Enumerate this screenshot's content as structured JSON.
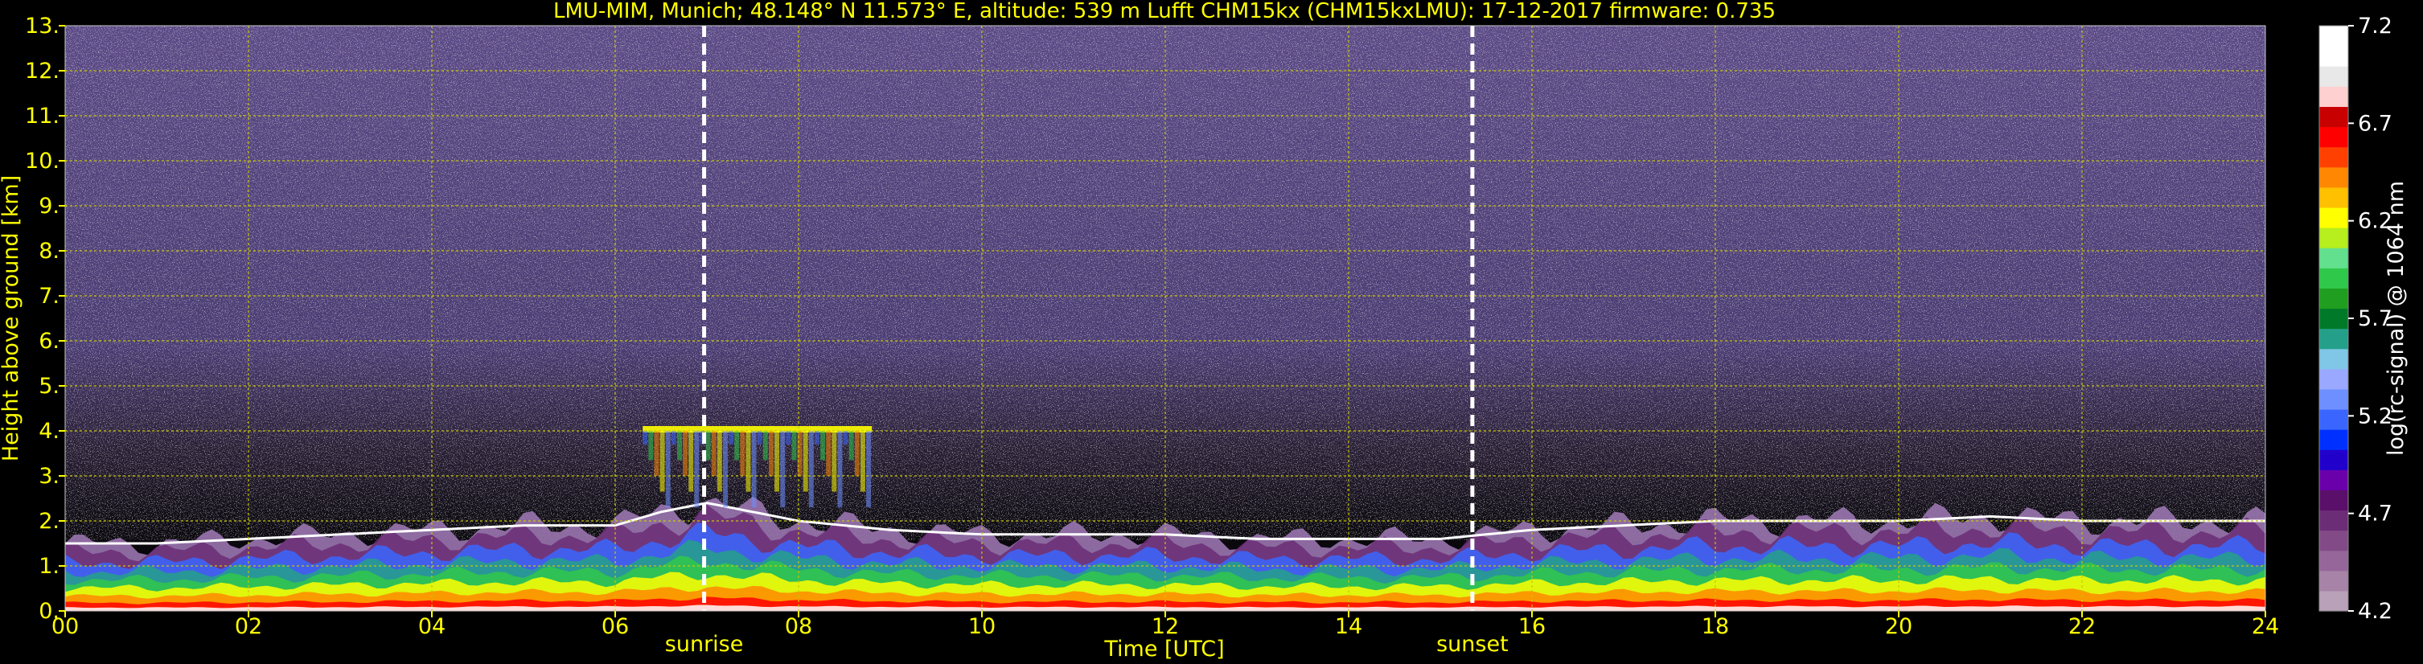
{
  "chart_data": {
    "type": "heatmap",
    "title": "LMU-MIM, Munich; 48.148° N 11.573° E, altitude: 539 m    Lufft CHM15kx (CHM15kxLMU): 17-12-2017    firmware: 0.735",
    "xlabel": "Time [UTC]",
    "ylabel": "Height above ground [km]",
    "xlim": [
      0,
      24
    ],
    "ylim": [
      0,
      13
    ],
    "x_ticks": [
      "00",
      "02",
      "04",
      "06",
      "08",
      "10",
      "12",
      "14",
      "16",
      "18",
      "20",
      "22",
      "24"
    ],
    "y_ticks": [
      "0.",
      "1.",
      "2.",
      "3.",
      "4.",
      "5.",
      "6.",
      "7.",
      "8.",
      "9.",
      "10.",
      "11.",
      "12.",
      "13."
    ],
    "grid": true,
    "markers": [
      {
        "label": "sunrise",
        "x": 6.97
      },
      {
        "label": "sunset",
        "x": 15.35
      }
    ],
    "colorbar": {
      "label": "log(rc-signal) @ 1064 nm",
      "ticks": [
        "4.2",
        "4.7",
        "5.2",
        "5.7",
        "6.2",
        "6.7",
        "7.2"
      ],
      "range": [
        4.2,
        7.2
      ],
      "colors": [
        "#b9a2b9",
        "#a783a7",
        "#96669a",
        "#824b87",
        "#6b2d76",
        "#5a0f6a",
        "#6a00aa",
        "#2200cc",
        "#0030ff",
        "#3a66ff",
        "#6e8fff",
        "#9aa9ff",
        "#80c6e6",
        "#24a08a",
        "#007a28",
        "#1f9e1f",
        "#30c84a",
        "#62e08e",
        "#b6ee1e",
        "#ffff00",
        "#ffc000",
        "#ff8800",
        "#ff4000",
        "#ff0000",
        "#c80000",
        "#ffd0d0",
        "#e8e8e8",
        "#ffffff",
        "#ffffff"
      ]
    },
    "boundary_layer_top_km": [
      [
        0,
        1.5
      ],
      [
        1,
        1.5
      ],
      [
        2,
        1.6
      ],
      [
        3,
        1.7
      ],
      [
        4,
        1.8
      ],
      [
        5,
        1.9
      ],
      [
        6,
        1.9
      ],
      [
        6.5,
        2.2
      ],
      [
        7,
        2.4
      ],
      [
        8,
        2.0
      ],
      [
        9,
        1.8
      ],
      [
        10,
        1.7
      ],
      [
        11,
        1.7
      ],
      [
        12,
        1.7
      ],
      [
        13,
        1.6
      ],
      [
        14,
        1.6
      ],
      [
        15,
        1.6
      ],
      [
        16,
        1.8
      ],
      [
        17,
        1.9
      ],
      [
        18,
        2.0
      ],
      [
        19,
        2.0
      ],
      [
        20,
        2.0
      ],
      [
        21,
        2.1
      ],
      [
        22,
        2.0
      ],
      [
        23,
        2.0
      ],
      [
        24,
        2.0
      ]
    ],
    "cloud_layer_km": {
      "x_start": 6.3,
      "x_end": 8.8,
      "height": 4.0
    }
  }
}
